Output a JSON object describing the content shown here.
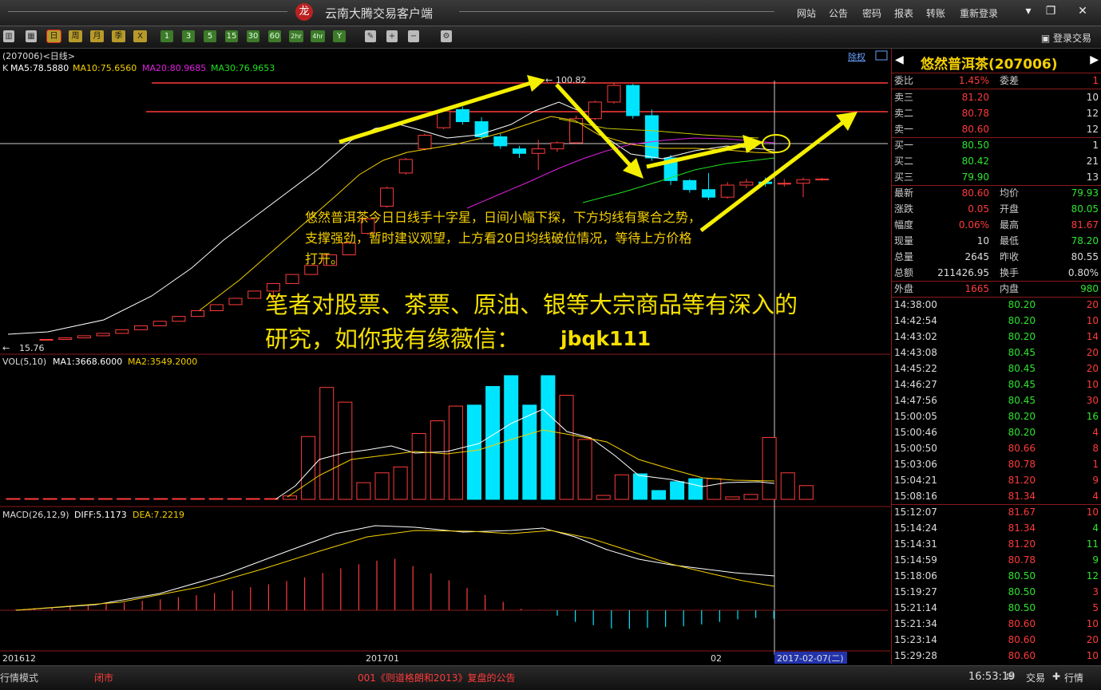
{
  "window": {
    "title": "云南大腾交易客户端",
    "logo_char": "龙"
  },
  "menu": [
    "网站",
    "公告",
    "密码",
    "报表",
    "转账",
    "重新登录"
  ],
  "window_buttons": {
    "minimize": "▾",
    "restore": "❐",
    "close": "✕"
  },
  "toolbar": {
    "periods": [
      "日",
      "周",
      "月",
      "季",
      "X"
    ],
    "minutes": [
      "1",
      "3",
      "5",
      "15",
      "30",
      "60",
      "2hr",
      "4hr",
      "Y"
    ],
    "login_label": "登录交易"
  },
  "chart": {
    "symbol_label": "(207006)<日线>",
    "adjust_label": "除权",
    "ma_prefix": "K",
    "ma": [
      {
        "label": "MA5:78.5880",
        "color": "#ffffff"
      },
      {
        "label": "MA10:75.6560",
        "color": "#f5d000"
      },
      {
        "label": "MA20:80.9685",
        "color": "#e020e0"
      },
      {
        "label": "MA30:76.9653",
        "color": "#20e020"
      }
    ],
    "high_label": "100.82",
    "low_label": "15.76",
    "vol_label": "VOL(5,10)",
    "vol_ma": [
      {
        "label": "MA1:3668.6000",
        "color": "#ffffff"
      },
      {
        "label": "MA2:3549.2000",
        "color": "#f5d000"
      }
    ],
    "macd_label": "MACD(26,12,9)",
    "macd_values": [
      {
        "label": "DIFF:5.1173",
        "color": "#ffffff"
      },
      {
        "label": "DEA:7.2219",
        "color": "#f5d000"
      }
    ],
    "x_labels": [
      "201612",
      "201701",
      "02"
    ],
    "cursor_date": "2017-02-07(二)",
    "annotation": [
      "悠然普洱茶今日日线手十字星，日间小幅下探，下方均线有聚合之势，",
      "支撑强劲，暂时建议观望，上方看20日均线破位情况，等待上方价格",
      "打开。"
    ],
    "promo": [
      "笔者对股票、茶票、原油、银等大宗商品等有深入的",
      "研究，如你我有缘薇信：",
      "jbqk111"
    ]
  },
  "quote": {
    "name": "悠然普洱茶(207006)",
    "ratio": {
      "label": "委比",
      "value": "1.45%",
      "label2": "委差",
      "value2": "1"
    },
    "asks": [
      {
        "label": "卖三",
        "price": "81.20",
        "qty": "10"
      },
      {
        "label": "卖二",
        "price": "80.78",
        "qty": "12"
      },
      {
        "label": "卖一",
        "price": "80.60",
        "qty": "12"
      }
    ],
    "bids": [
      {
        "label": "买一",
        "price": "80.50",
        "qty": "1"
      },
      {
        "label": "买二",
        "price": "80.42",
        "qty": "21"
      },
      {
        "label": "买三",
        "price": "79.90",
        "qty": "13"
      }
    ],
    "stats": [
      {
        "l": "最新",
        "v": "80.60",
        "vc": "red",
        "l2": "均价",
        "v2": "79.93",
        "v2c": "green"
      },
      {
        "l": "涨跌",
        "v": "0.05",
        "vc": "red",
        "l2": "开盘",
        "v2": "80.05",
        "v2c": "green"
      },
      {
        "l": "幅度",
        "v": "0.06%",
        "vc": "red",
        "l2": "最高",
        "v2": "81.67",
        "v2c": "red"
      },
      {
        "l": "现量",
        "v": "10",
        "vc": "white",
        "l2": "最低",
        "v2": "78.20",
        "v2c": "green"
      },
      {
        "l": "总量",
        "v": "2645",
        "vc": "white",
        "l2": "昨收",
        "v2": "80.55",
        "v2c": "white"
      },
      {
        "l": "总额",
        "v": "211426.95",
        "vc": "white",
        "l2": "换手",
        "v2": "0.80%",
        "v2c": "white"
      },
      {
        "l": "外盘",
        "v": "1665",
        "vc": "red",
        "l2": "内盘",
        "v2": "980",
        "v2c": "green"
      }
    ],
    "ticks": [
      {
        "t": "14:38:00",
        "p": "80.20",
        "pc": "green",
        "q": "20",
        "qc": "red"
      },
      {
        "t": "14:42:54",
        "p": "80.20",
        "pc": "green",
        "q": "10",
        "qc": "red"
      },
      {
        "t": "14:43:02",
        "p": "80.20",
        "pc": "green",
        "q": "14",
        "qc": "red"
      },
      {
        "t": "14:43:08",
        "p": "80.45",
        "pc": "green",
        "q": "20",
        "qc": "red"
      },
      {
        "t": "14:45:22",
        "p": "80.45",
        "pc": "green",
        "q": "20",
        "qc": "red"
      },
      {
        "t": "14:46:27",
        "p": "80.45",
        "pc": "green",
        "q": "10",
        "qc": "red"
      },
      {
        "t": "14:47:56",
        "p": "80.45",
        "pc": "green",
        "q": "30",
        "qc": "red"
      },
      {
        "t": "15:00:05",
        "p": "80.20",
        "pc": "green",
        "q": "16",
        "qc": "green"
      },
      {
        "t": "15:00:46",
        "p": "80.20",
        "pc": "green",
        "q": "4",
        "qc": "red"
      },
      {
        "t": "15:00:50",
        "p": "80.66",
        "pc": "red",
        "q": "8",
        "qc": "red"
      },
      {
        "t": "15:03:06",
        "p": "80.78",
        "pc": "red",
        "q": "1",
        "qc": "red"
      },
      {
        "t": "15:04:21",
        "p": "81.20",
        "pc": "red",
        "q": "9",
        "qc": "red"
      },
      {
        "t": "15:08:16",
        "p": "81.34",
        "pc": "red",
        "q": "4",
        "qc": "red"
      },
      {
        "t": "15:12:07",
        "p": "81.67",
        "pc": "red",
        "q": "10",
        "qc": "red"
      },
      {
        "t": "15:14:24",
        "p": "81.34",
        "pc": "red",
        "q": "4",
        "qc": "green"
      },
      {
        "t": "15:14:31",
        "p": "81.20",
        "pc": "red",
        "q": "11",
        "qc": "green"
      },
      {
        "t": "15:14:59",
        "p": "80.78",
        "pc": "red",
        "q": "9",
        "qc": "green"
      },
      {
        "t": "15:18:06",
        "p": "80.50",
        "pc": "green",
        "q": "12",
        "qc": "green"
      },
      {
        "t": "15:19:27",
        "p": "80.50",
        "pc": "green",
        "q": "3",
        "qc": "red"
      },
      {
        "t": "15:21:14",
        "p": "80.50",
        "pc": "green",
        "q": "5",
        "qc": "red"
      },
      {
        "t": "15:21:34",
        "p": "80.60",
        "pc": "red",
        "q": "10",
        "qc": "red"
      },
      {
        "t": "15:23:14",
        "p": "80.60",
        "pc": "red",
        "q": "20",
        "qc": "red"
      },
      {
        "t": "15:29:28",
        "p": "80.60",
        "pc": "red",
        "q": "10",
        "qc": "red"
      }
    ]
  },
  "statusbar": {
    "mode": "行情模式",
    "market_status": "闭市",
    "news": "001《则道格朗和2013》复盘的公告",
    "time": "16:53:19",
    "trade": "交易",
    "quote": "行情"
  },
  "colors": {
    "up": "#ff3b3b",
    "down": "#00e5ff",
    "arrow": "#f5f000",
    "text_yellow": "#f5d000"
  },
  "candles": [
    [
      15.76,
      15.9,
      15.7,
      15.9
    ],
    [
      15.9,
      16.5,
      15.9,
      16.4
    ],
    [
      16.4,
      17.2,
      16.3,
      17.1
    ],
    [
      17.1,
      18,
      17,
      17.9
    ],
    [
      17.9,
      19.2,
      17.8,
      19.1
    ],
    [
      19.1,
      20.5,
      19,
      20.4
    ],
    [
      20.4,
      22,
      20.3,
      21.9
    ],
    [
      21.9,
      23.6,
      21.8,
      23.5
    ],
    [
      23.5,
      25.5,
      23.4,
      25.4
    ],
    [
      25.4,
      27.5,
      25.3,
      27.4
    ],
    [
      27.4,
      29.6,
      27.3,
      29.5
    ],
    [
      29.5,
      32,
      29.4,
      31.9
    ],
    [
      31.9,
      34.5,
      28,
      34.4
    ],
    [
      34.4,
      37.5,
      34.3,
      37.4
    ],
    [
      37.4,
      40.5,
      37.3,
      40.4
    ],
    [
      40.4,
      44,
      40.3,
      43.9
    ],
    [
      43.9,
      48,
      43.8,
      47.8
    ],
    [
      51,
      56,
      50.5,
      55.8
    ],
    [
      60,
      66.5,
      59.5,
      66
    ],
    [
      71,
      76,
      70.5,
      75.5
    ],
    [
      79,
      84,
      78.5,
      83.5
    ],
    [
      86,
      92,
      85.5,
      91.5
    ],
    [
      92,
      93,
      87,
      88
    ],
    [
      88,
      89.5,
      82,
      83
    ],
    [
      83,
      84,
      79,
      80
    ],
    [
      79,
      80,
      76,
      77.5
    ],
    [
      77.5,
      82,
      72,
      79
    ],
    [
      79,
      81.5,
      78,
      81
    ],
    [
      81,
      90,
      80.5,
      89
    ],
    [
      89,
      95,
      88.5,
      94.5
    ],
    [
      94.5,
      100.82,
      94,
      100
    ],
    [
      100,
      100.5,
      89,
      90
    ],
    [
      90,
      92,
      75,
      76
    ],
    [
      76,
      77,
      67,
      68.5
    ],
    [
      68.5,
      69,
      64.5,
      65.5
    ],
    [
      65.5,
      71,
      62,
      63
    ],
    [
      63,
      68,
      62.5,
      67
    ],
    [
      67,
      69,
      66,
      68
    ],
    [
      68,
      69.5,
      66.5,
      67.5
    ],
    [
      67.5,
      69,
      66.5,
      67.6
    ],
    [
      67.6,
      69.5,
      63,
      68.8
    ],
    [
      68.8,
      69.4,
      68.5,
      69
    ]
  ],
  "volumes": [
    0.5,
    0.5,
    0.5,
    0.5,
    0.5,
    0.5,
    0.5,
    0.5,
    0.5,
    0.5,
    0.5,
    0.5,
    0.5,
    0.5,
    0.5,
    3.5,
    64,
    114,
    99,
    17,
    27,
    33,
    67,
    80,
    95,
    96,
    115,
    126,
    96,
    126,
    106,
    61,
    4,
    25,
    26,
    9,
    18,
    21,
    21,
    2.5,
    5,
    63,
    27,
    14
  ],
  "macd_hist": [
    0.3,
    0.5,
    0.8,
    1,
    1.4,
    1.8,
    2.1,
    2.6,
    3,
    3.6,
    4.1,
    4.7,
    5.4,
    6.3,
    7.1,
    8,
    9,
    10.2,
    11.5,
    12.6,
    13.6,
    14.1,
    12.1,
    10.1,
    8.2,
    6.1,
    4.2,
    2.3,
    0.4,
    0.1,
    -1.5,
    -3.2,
    -4.1,
    -5,
    -5.1,
    -4.8,
    -4.6,
    -4.4,
    -3.9,
    -3.2,
    -2.5,
    -2.1,
    -2.3
  ]
}
